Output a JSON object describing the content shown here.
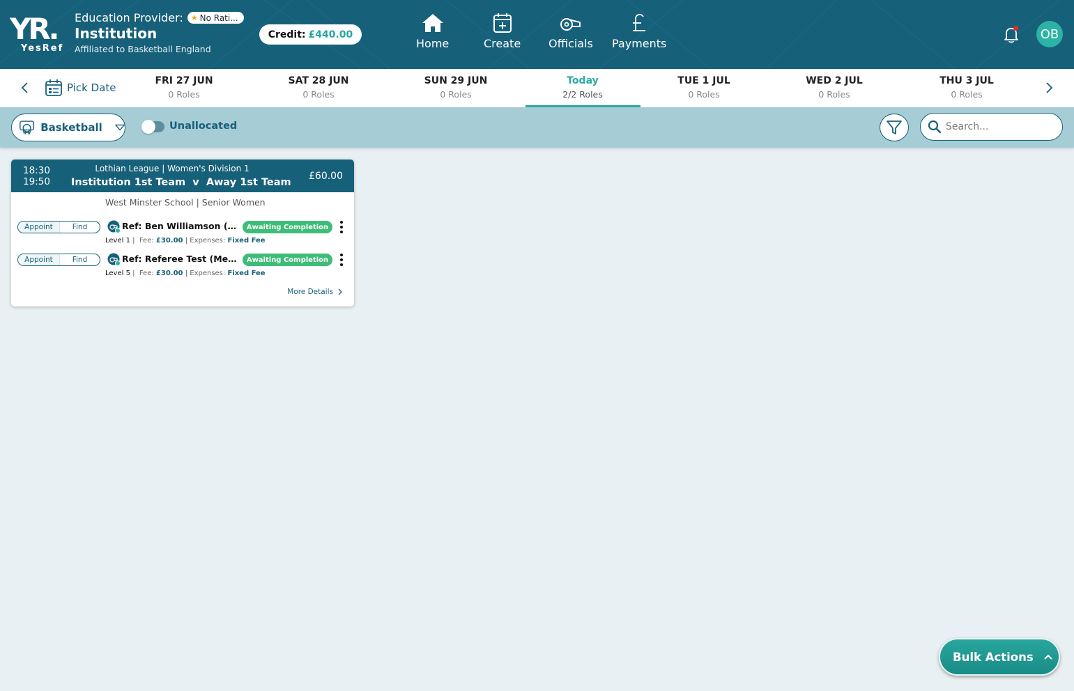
{
  "header": {
    "logo_text": "YR.",
    "logo_subtext": "YesRef",
    "provider_label": "Education Provider:",
    "rating": "No Rati...",
    "institution": "Institution",
    "affiliation": "Affiliated to Basketball England",
    "credit_label": "Credit:",
    "credit_amount": "£440.00",
    "nav": [
      {
        "label": "Home",
        "icon": "home-icon"
      },
      {
        "label": "Create",
        "icon": "calendar-plus-icon"
      },
      {
        "label": "Officials",
        "icon": "whistle-icon"
      },
      {
        "label": "Payments",
        "icon": "pound-icon"
      }
    ],
    "avatar_initials": "OB",
    "colors": {
      "primary": "#17607a",
      "accent": "#2aa9a2",
      "status_green": "#3dbd78"
    }
  },
  "datebar": {
    "pick_label": "Pick Date",
    "days": [
      {
        "date": "FRI 27 JUN",
        "roles": "0 Roles"
      },
      {
        "date": "SAT 28 JUN",
        "roles": "0 Roles"
      },
      {
        "date": "SUN 29 JUN",
        "roles": "0 Roles"
      },
      {
        "date": "Today",
        "roles": "2/2 Roles"
      },
      {
        "date": "TUE 1 JUL",
        "roles": "0 Roles"
      },
      {
        "date": "WED 2 JUL",
        "roles": "0 Roles"
      },
      {
        "date": "THU 3 JUL",
        "roles": "0 Roles"
      }
    ],
    "active_index": 3
  },
  "filters": {
    "sport": "Basketball",
    "unallocated_label": "Unallocated",
    "unallocated_on": false,
    "search_placeholder": "Search..."
  },
  "fixture": {
    "start": "18:30",
    "end": "19:50",
    "league": "Lothian League | Women's Division 1",
    "home": "Institution 1st Team",
    "vs": "v",
    "away": "Away 1st Team",
    "price": "£60.00",
    "venue": "West Minster School | Senior Women",
    "roles": [
      {
        "appoint": "Appoint",
        "find": "Find",
        "ref": "Ref: Ben Williamson (Melksham)",
        "status": "Awaiting Completion",
        "level": "Level 1",
        "fee_label": "Fee:",
        "fee": "£30.00",
        "expenses_label": "Expenses:",
        "expenses": "Fixed Fee"
      },
      {
        "appoint": "Appoint",
        "find": "Find",
        "ref": "Ref: Referee Test (Melksham)",
        "status": "Awaiting Completion",
        "level": "Level 5",
        "fee_label": "Fee:",
        "fee": "£30.00",
        "expenses_label": "Expenses:",
        "expenses": "Fixed Fee"
      }
    ],
    "more_details": "More Details"
  },
  "bulk_actions": "Bulk Actions"
}
